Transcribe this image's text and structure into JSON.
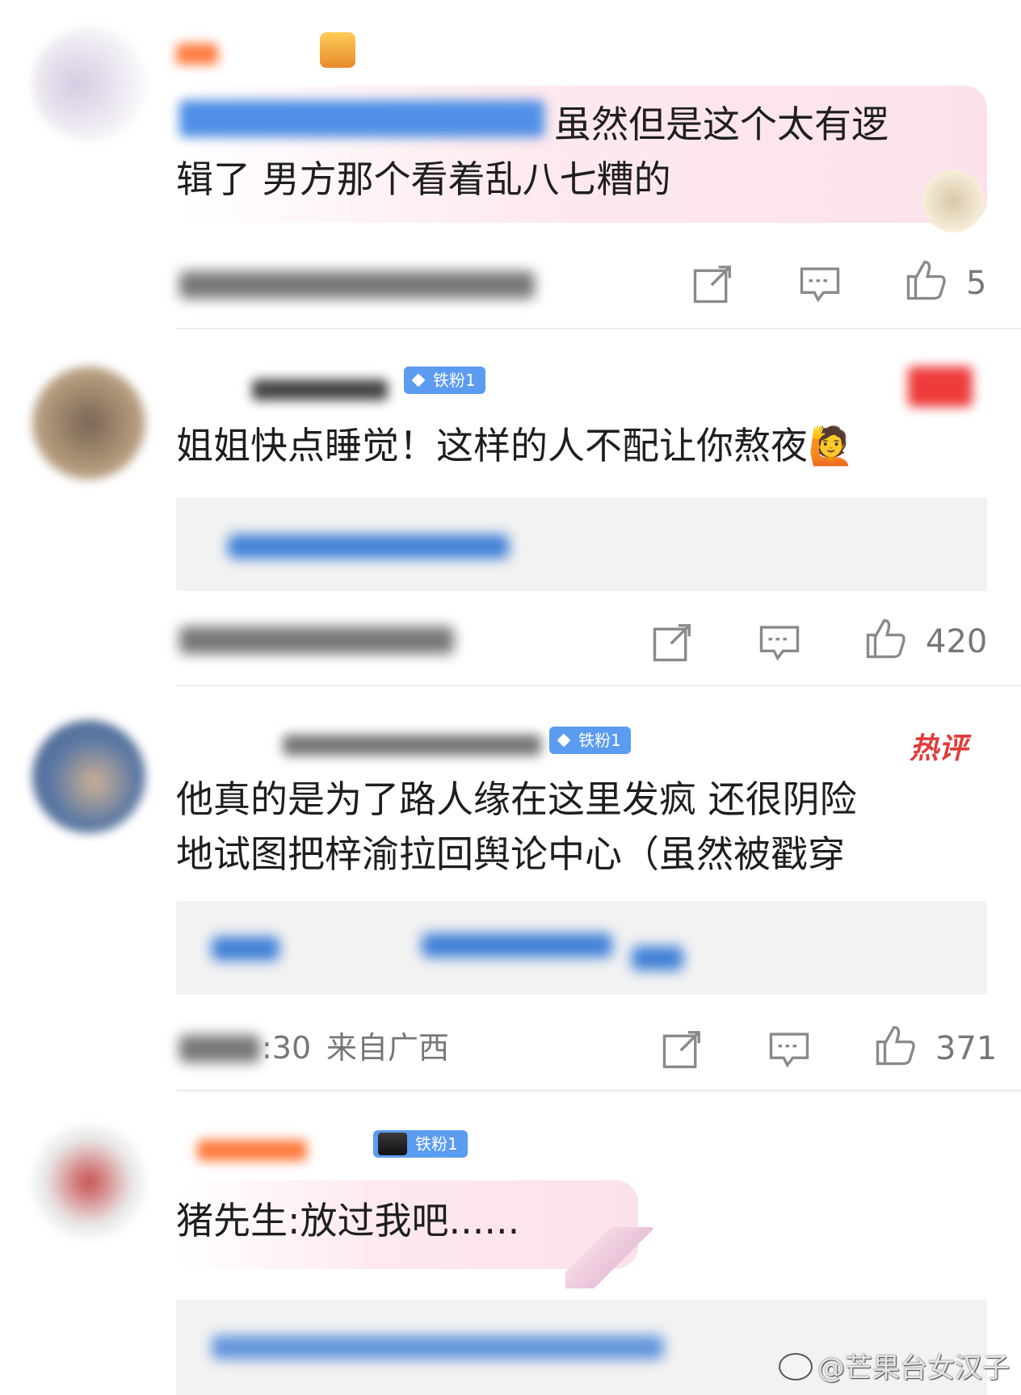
{
  "comments": [
    {
      "text": "虽然但是这个太有逻\n辑了 男方那个看着乱八七糟的",
      "like_count": "5"
    },
    {
      "badge": "铁粉1",
      "text": "姐姐快点睡觉！这样的人不配让你熬夜🙋",
      "like_count": "420"
    },
    {
      "badge": "铁粉1",
      "hot_label": "热评",
      "text": "他真的是为了路人缘在这里发疯 还很阴险\n地试图把梓渝拉回舆论中心（虽然被戳穿",
      "meta_time": ":30",
      "meta_location": "来自广西",
      "like_count": "371"
    },
    {
      "badge": "铁粉1",
      "text": "猪先生:放过我吧......"
    }
  ],
  "watermark": "@芒果台女汉子",
  "icons": [
    "share-icon",
    "comment-icon",
    "like-icon",
    "weibo-logo-icon",
    "crown-icon"
  ],
  "colors": {
    "badge": "#5b9bf0",
    "hot": "#e03c3c",
    "meta": "#777777",
    "reply_box": "#f2f2f2"
  }
}
